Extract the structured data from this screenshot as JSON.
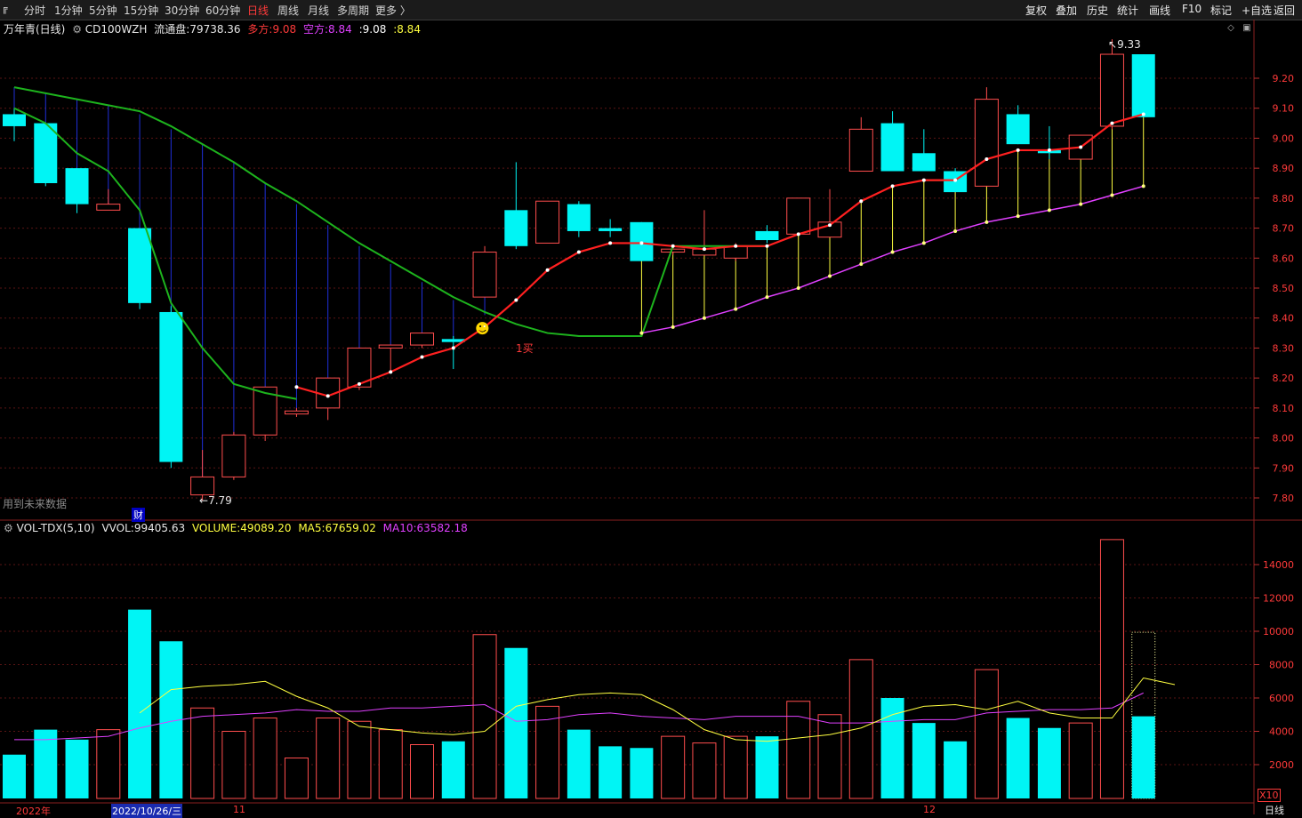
{
  "toolbar": {
    "periods": [
      "分时",
      "1分钟",
      "5分钟",
      "15分钟",
      "30分钟",
      "60分钟",
      "日线",
      "周线",
      "月线",
      "多周期",
      "更多 〉"
    ],
    "active_period": "日线",
    "right_buttons": [
      "复权",
      "叠加",
      "历史",
      "统计",
      "画线",
      "F10",
      "标记",
      "+自选",
      "返回"
    ]
  },
  "chart_header": {
    "name": "万年青(日线)",
    "indicator": "CD100WZH",
    "float_label": "流通盘:",
    "float_value": "79738.36",
    "long_label": "多方:",
    "long_value": "9.08",
    "short_label": "空方:",
    "short_value": "8.84",
    "extra1": ":9.08",
    "extra2": ":8.84"
  },
  "annotations": {
    "high_label": "9.33",
    "low_label": "7.79",
    "buy_label": "1买",
    "future_data": "用到未来数据",
    "finance_marker": "财",
    "smiley": "☻"
  },
  "volume_header": {
    "name": "VOL-TDX(5,10)",
    "vvol_label": "VVOL:",
    "vvol_value": "99405.63",
    "volume_label": "VOLUME:",
    "volume_value": "49089.20",
    "ma5_label": "MA5:",
    "ma5_value": "67659.02",
    "ma10_label": "MA10:",
    "ma10_value": "63582.18"
  },
  "footer": {
    "year_label": "2022年",
    "cursor_date": "2022/10/26/三",
    "month_11": "11",
    "month_12": "12",
    "x_scale": "X10",
    "period_tag": "日线"
  },
  "colors": {
    "up": "#ff4d4d",
    "down": "#00f5f5",
    "green_ma": "#1db31d",
    "red_line": "#ff2020",
    "yellow": "#ffff40",
    "magenta": "#e040ff",
    "blue_stem": "#1f2fd8"
  },
  "chart_data": [
    {
      "type": "candlestick",
      "title": "万年青(日线)",
      "y_axis": {
        "ticks": [
          7.8,
          7.9,
          8.0,
          8.1,
          8.2,
          8.3,
          8.4,
          8.5,
          8.6,
          8.7,
          8.8,
          8.9,
          9.0,
          9.1,
          9.2
        ]
      },
      "candles": [
        {
          "o": 9.08,
          "h": 9.1,
          "l": 8.99,
          "c": 9.04
        },
        {
          "o": 9.05,
          "h": 9.05,
          "l": 8.84,
          "c": 8.85
        },
        {
          "o": 8.9,
          "h": 8.9,
          "l": 8.75,
          "c": 8.78
        },
        {
          "o": 8.76,
          "h": 8.83,
          "l": 8.76,
          "c": 8.78
        },
        {
          "o": 8.7,
          "h": 8.7,
          "l": 8.43,
          "c": 8.45
        },
        {
          "o": 8.42,
          "h": 8.44,
          "l": 7.9,
          "c": 7.92
        },
        {
          "o": 7.81,
          "h": 7.96,
          "l": 7.79,
          "c": 7.87
        },
        {
          "o": 7.87,
          "h": 8.02,
          "l": 7.86,
          "c": 8.01
        },
        {
          "o": 8.01,
          "h": 8.17,
          "l": 7.99,
          "c": 8.17
        },
        {
          "o": 8.08,
          "h": 8.1,
          "l": 8.07,
          "c": 8.09
        },
        {
          "o": 8.1,
          "h": 8.2,
          "l": 8.06,
          "c": 8.2
        },
        {
          "o": 8.17,
          "h": 8.3,
          "l": 8.16,
          "c": 8.3
        },
        {
          "o": 8.3,
          "h": 8.31,
          "l": 8.22,
          "c": 8.31
        },
        {
          "o": 8.31,
          "h": 8.35,
          "l": 8.3,
          "c": 8.35
        },
        {
          "o": 8.33,
          "h": 8.34,
          "l": 8.23,
          "c": 8.32
        },
        {
          "o": 8.47,
          "h": 8.64,
          "l": 8.47,
          "c": 8.62
        },
        {
          "o": 8.76,
          "h": 8.92,
          "l": 8.63,
          "c": 8.64
        },
        {
          "o": 8.65,
          "h": 8.79,
          "l": 8.65,
          "c": 8.79
        },
        {
          "o": 8.78,
          "h": 8.79,
          "l": 8.67,
          "c": 8.69
        },
        {
          "o": 8.7,
          "h": 8.73,
          "l": 8.67,
          "c": 8.69
        },
        {
          "o": 8.72,
          "h": 8.72,
          "l": 8.59,
          "c": 8.59
        },
        {
          "o": 8.62,
          "h": 8.64,
          "l": 8.61,
          "c": 8.63
        },
        {
          "o": 8.61,
          "h": 8.76,
          "l": 8.61,
          "c": 8.63
        },
        {
          "o": 8.6,
          "h": 8.65,
          "l": 8.59,
          "c": 8.64
        },
        {
          "o": 8.69,
          "h": 8.71,
          "l": 8.65,
          "c": 8.66
        },
        {
          "o": 8.68,
          "h": 8.8,
          "l": 8.68,
          "c": 8.8
        },
        {
          "o": 8.67,
          "h": 8.83,
          "l": 8.67,
          "c": 8.72
        },
        {
          "o": 8.89,
          "h": 9.07,
          "l": 8.89,
          "c": 9.03
        },
        {
          "o": 9.05,
          "h": 9.09,
          "l": 8.89,
          "c": 8.89
        },
        {
          "o": 8.95,
          "h": 9.03,
          "l": 8.89,
          "c": 8.89
        },
        {
          "o": 8.89,
          "h": 8.9,
          "l": 8.82,
          "c": 8.82
        },
        {
          "o": 8.84,
          "h": 9.17,
          "l": 8.84,
          "c": 9.13
        },
        {
          "o": 9.08,
          "h": 9.11,
          "l": 8.98,
          "c": 8.98
        },
        {
          "o": 8.96,
          "h": 9.04,
          "l": 8.93,
          "c": 8.95
        },
        {
          "o": 8.93,
          "h": 9.01,
          "l": 8.93,
          "c": 9.01
        },
        {
          "o": 9.04,
          "h": 9.33,
          "l": 9.03,
          "c": 9.28
        },
        {
          "o": 9.28,
          "h": 9.28,
          "l": 9.07,
          "c": 9.07
        }
      ],
      "series": [
        {
          "name": "多方",
          "values": [
            9.1,
            9.05,
            8.95,
            8.9,
            8.78,
            8.6,
            8.4,
            8.3,
            8.22,
            8.17,
            8.14,
            8.18,
            8.22,
            8.27,
            8.3,
            8.37,
            8.46,
            8.56,
            8.62,
            8.65,
            8.65,
            8.64,
            8.63,
            8.64,
            8.64,
            8.68,
            8.71,
            8.79,
            8.84,
            8.86,
            8.86,
            8.93,
            8.96,
            8.96,
            8.97,
            9.05,
            9.08
          ]
        },
        {
          "name": "空方",
          "values": [
            null,
            null,
            null,
            null,
            null,
            null,
            null,
            null,
            null,
            null,
            null,
            null,
            null,
            null,
            null,
            null,
            null,
            null,
            null,
            null,
            8.35,
            8.37,
            8.4,
            8.43,
            8.47,
            8.5,
            8.54,
            8.58,
            8.62,
            8.65,
            8.69,
            8.72,
            8.74,
            8.76,
            8.78,
            8.81,
            8.84
          ]
        }
      ]
    },
    {
      "type": "bar",
      "title": "VOL-TDX(5,10)",
      "y_axis": {
        "ticks": [
          2000,
          4000,
          6000,
          8000,
          10000,
          12000,
          14000
        ],
        "unit": "X10"
      },
      "values": [
        2600,
        4100,
        3500,
        4100,
        11300,
        9400,
        5400,
        4000,
        4800,
        2400,
        4800,
        4600,
        4100,
        3200,
        3400,
        9800,
        9000,
        5500,
        4100,
        3100,
        3000,
        3700,
        3300,
        3700,
        3700,
        5800,
        5000,
        8300,
        6000,
        4500,
        3400,
        7700,
        4800,
        4200,
        4500,
        15500,
        4900
      ],
      "series": [
        {
          "name": "MA5",
          "values": [
            null,
            null,
            null,
            null,
            5100,
            6500,
            6700,
            6800,
            7000,
            6100,
            5400,
            4300,
            4100,
            3900,
            3800,
            4000,
            5500,
            5900,
            6200,
            6300,
            6200,
            5300,
            4100,
            3500,
            3400,
            3600,
            3800,
            4200,
            5000,
            5500,
            5600,
            5300,
            5800,
            5100,
            4800,
            4800,
            7200,
            6800
          ]
        },
        {
          "name": "MA10",
          "values": [
            3500,
            3500,
            3600,
            3700,
            4200,
            4600,
            4900,
            5000,
            5100,
            5300,
            5200,
            5200,
            5400,
            5400,
            5500,
            5600,
            4600,
            4700,
            5000,
            5100,
            4900,
            4800,
            4700,
            4900,
            4900,
            4900,
            4500,
            4500,
            4600,
            4700,
            4700,
            5100,
            5200,
            5300,
            5300,
            5400,
            6300
          ]
        }
      ]
    }
  ]
}
